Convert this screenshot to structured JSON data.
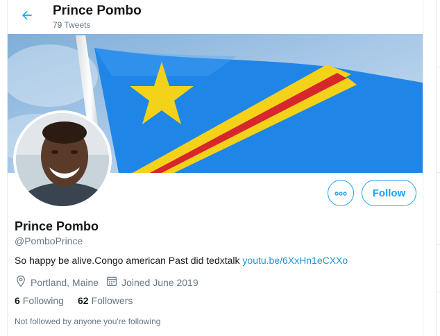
{
  "header": {
    "title": "Prince Pombo",
    "tweet_count": "79 Tweets"
  },
  "banner": {
    "description_icon": "drc-flag-image",
    "colors": {
      "sky": "#9cc1e4",
      "flag_blue": "#1f86e8",
      "flag_red": "#d8262d",
      "flag_yellow": "#f4d21a"
    }
  },
  "avatar": {
    "icon": "profile-photo"
  },
  "actions": {
    "more_icon": "more-options-icon",
    "follow_label": "Follow"
  },
  "profile": {
    "name": "Prince Pombo",
    "handle": "@PomboPrince",
    "bio_text": "So happy be alive.Congo american Past did tedxtalk ",
    "bio_link": "youtu.be/6XxHn1eCXXo",
    "location": "Portland, Maine",
    "joined": "Joined June 2019"
  },
  "counts": {
    "following_value": "6",
    "following_label": "Following",
    "followers_value": "62",
    "followers_label": "Followers"
  },
  "followed_note": "Not followed by anyone you're following",
  "colors": {
    "accent": "#1da1f2",
    "text": "#14171a",
    "muted": "#657786",
    "border": "#e6ecf0"
  }
}
